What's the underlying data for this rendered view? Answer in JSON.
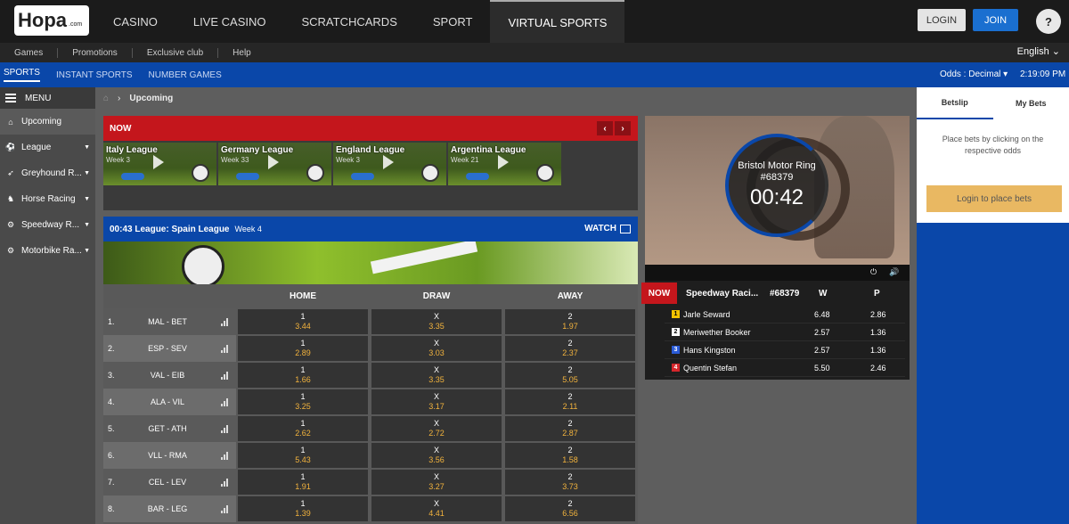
{
  "brand": {
    "logo_text": "Hopa",
    "logo_suffix": ".com"
  },
  "nav": {
    "items": [
      "CASINO",
      "LIVE CASINO",
      "SCRATCHCARDS",
      "SPORT",
      "VIRTUAL SPORTS"
    ]
  },
  "auth": {
    "login": "LOGIN",
    "join": "JOIN"
  },
  "subnav": {
    "items": [
      "Games",
      "Promotions",
      "Exclusive club",
      "Help"
    ],
    "language": "English"
  },
  "sportsbar": {
    "tabs": [
      "SPORTS",
      "INSTANT SPORTS",
      "NUMBER GAMES"
    ],
    "odds_format": "Odds : Decimal",
    "time": "2:19:09 PM"
  },
  "sidebar": {
    "menu_label": "MENU",
    "items": [
      {
        "label": "Upcoming",
        "icon": "home-icon"
      },
      {
        "label": "League",
        "icon": "soccer-ball-icon"
      },
      {
        "label": "Greyhound R...",
        "icon": "greyhound-icon"
      },
      {
        "label": "Horse Racing",
        "icon": "horse-icon"
      },
      {
        "label": "Speedway R...",
        "icon": "speedway-icon"
      },
      {
        "label": "Motorbike Ra...",
        "icon": "motorbike-icon"
      }
    ]
  },
  "breadcrumb": {
    "current": "Upcoming"
  },
  "now_panel": {
    "label": "NOW",
    "leagues": [
      {
        "name": "Italy League",
        "week": "Week 3"
      },
      {
        "name": "Germany League",
        "week": "Week 33"
      },
      {
        "name": "England League",
        "week": "Week 3"
      },
      {
        "name": "Argentina League",
        "week": "Week 21"
      }
    ]
  },
  "match": {
    "title": "00:43 League: Spain League",
    "week": "Week 4",
    "watch": "WATCH"
  },
  "odds_table": {
    "headers": [
      "HOME",
      "DRAW",
      "AWAY"
    ],
    "rows": [
      {
        "num": "1.",
        "teams": "MAL  -  BET",
        "h": "3.44",
        "d": "3.35",
        "a": "1.97"
      },
      {
        "num": "2.",
        "teams": "ESP  -  SEV",
        "h": "2.89",
        "d": "3.03",
        "a": "2.37"
      },
      {
        "num": "3.",
        "teams": "VAL  -  EIB",
        "h": "1.66",
        "d": "3.35",
        "a": "5.05"
      },
      {
        "num": "4.",
        "teams": "ALA  -  VIL",
        "h": "3.25",
        "d": "3.17",
        "a": "2.11"
      },
      {
        "num": "5.",
        "teams": "GET  -  ATH",
        "h": "2.62",
        "d": "2.72",
        "a": "2.87"
      },
      {
        "num": "6.",
        "teams": "VLL  -  RMA",
        "h": "5.43",
        "d": "3.56",
        "a": "1.58"
      },
      {
        "num": "7.",
        "teams": "CEL  -  LEV",
        "h": "1.91",
        "d": "3.27",
        "a": "3.73"
      },
      {
        "num": "8.",
        "teams": "BAR  -  LEG",
        "h": "1.39",
        "d": "4.41",
        "a": "6.56"
      }
    ],
    "keys": {
      "home": "1",
      "draw": "X",
      "away": "2"
    }
  },
  "video": {
    "track": "Bristol Motor Ring",
    "race_id": "#68379",
    "countdown": "00:42"
  },
  "race": {
    "now": "NOW",
    "name": "Speedway Raci...",
    "id": "#68379",
    "w_label": "W",
    "p_label": "P",
    "runners": [
      {
        "pos": "1",
        "name": "Jarle Seward",
        "w": "6.48",
        "p": "2.86",
        "color": "#f2c200"
      },
      {
        "pos": "2",
        "name": "Meriwether Booker",
        "w": "2.57",
        "p": "1.36",
        "color": "#ffffff"
      },
      {
        "pos": "3",
        "name": "Hans Kingston",
        "w": "2.57",
        "p": "1.36",
        "color": "#2a5bd7"
      },
      {
        "pos": "4",
        "name": "Quentin Stefan",
        "w": "5.50",
        "p": "2.46",
        "color": "#d6262b"
      }
    ]
  },
  "betslip": {
    "tabs": [
      "Betslip",
      "My Bets"
    ],
    "message": "Place bets by clicking on the respective odds",
    "login_btn": "Login to place bets"
  }
}
